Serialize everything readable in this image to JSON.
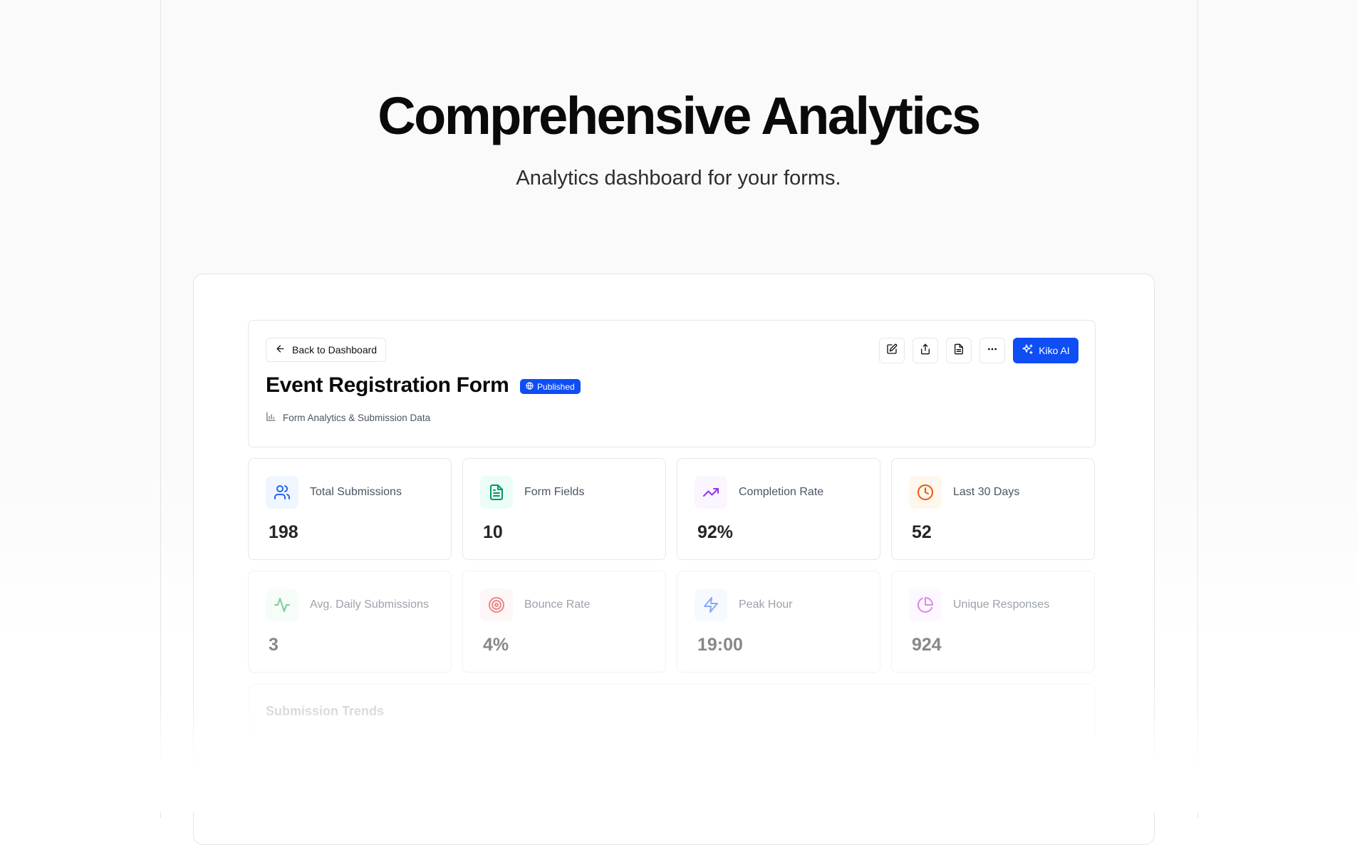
{
  "hero": {
    "title": "Comprehensive Analytics",
    "subtitle": "Analytics dashboard for your forms."
  },
  "header": {
    "back_label": "Back to Dashboard",
    "form_title": "Event Registration Form",
    "status_badge": "Published",
    "subtitle": "Form Analytics & Submission Data",
    "toolbar": {
      "edit_icon": "pencil-square-icon",
      "share_icon": "share-upload-icon",
      "document_icon": "document-icon",
      "more_icon": "more-horizontal-icon"
    },
    "ai_button_label": "Kiko AI",
    "accent_color": "#0f4df5"
  },
  "stats": [
    {
      "label": "Total Submissions",
      "value": "198",
      "icon": "users-icon",
      "color": "#2563eb",
      "bg": "#eff6ff"
    },
    {
      "label": "Form Fields",
      "value": "10",
      "icon": "file-text-icon",
      "color": "#059669",
      "bg": "#ecfdf5"
    },
    {
      "label": "Completion Rate",
      "value": "92%",
      "icon": "trending-up-icon",
      "color": "#9333ea",
      "bg": "#faf5ff"
    },
    {
      "label": "Last 30 Days",
      "value": "52",
      "icon": "clock-icon",
      "color": "#ea580c",
      "bg": "#fff7ed"
    },
    {
      "label": "Avg. Daily Submissions",
      "value": "3",
      "icon": "activity-icon",
      "color": "#16a34a",
      "bg": "#f0fdf4"
    },
    {
      "label": "Bounce Rate",
      "value": "4%",
      "icon": "target-icon",
      "color": "#dc2626",
      "bg": "#fef2f2"
    },
    {
      "label": "Peak Hour",
      "value": "19:00",
      "icon": "zap-icon",
      "color": "#2563eb",
      "bg": "#eff6ff"
    },
    {
      "label": "Unique Responses",
      "value": "924",
      "icon": "pie-chart-icon",
      "color": "#c026d3",
      "bg": "#fdf4ff"
    }
  ],
  "trends": {
    "title": "Submission Trends"
  }
}
